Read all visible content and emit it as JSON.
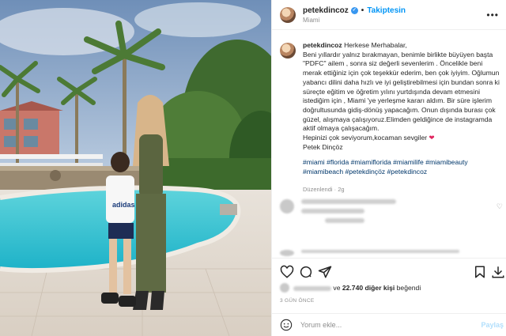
{
  "post": {
    "username": "petekdincoz",
    "verified_icon": "verified-badge-icon",
    "separator": "•",
    "follow_label": "Takiptesin",
    "location": "Miami",
    "more_icon": "more-options-icon"
  },
  "caption": {
    "username": "petekdincoz",
    "heart_emoji": "❤",
    "text_lines": [
      "Herkese Merhabalar,",
      "Beni yıllardır yalnız bırakmayan, benimle birlikte büyüyen başta \"PDFC\" ailem , sonra siz değerli sevenlerim . Öncelikle beni merak ettiğiniz için çok teşekkür ederim, ben çok iyiyim. Oğlumun yabancı dilini daha hızlı ve iyi geliştirebilmesi için bundan sonra ki süreçte eğitim ve öğretim yılını yurtdışında devam etmesini istediğim için , Miami 'ye yerleşme kararı aldım. Bir süre işlerim doğrultusunda gidiş-dönüş yapacağım. Onun dışında burası çok güzel, alışmaya çalışıyoruz.Elimden geldiğince de instagramda aktif olmaya çalışacağım.",
      "Hepinizi çok seviyorum,kocaman sevgiler",
      "Petek Dinçöz"
    ],
    "hashtags": "#miami #florida #miamiflorida #miamilife #miamibeauty #miamibeach #petekdinçöz #petekdincoz",
    "edited": "Düzenlendi · 2g"
  },
  "likes": {
    "prefix": "ve",
    "count_text": "22.740 diğer kişi",
    "suffix": "beğendi"
  },
  "post_time": "3 GÜN ÖNCE",
  "comment_box": {
    "placeholder": "Yorum ekle...",
    "post_label": "Paylaş"
  },
  "icons": [
    "heart-icon",
    "comment-icon",
    "share-icon",
    "save-icon",
    "download-icon",
    "emoji-icon"
  ],
  "colors": {
    "accent": "#0095f6",
    "verified": "#3897f0",
    "text": "#262626",
    "muted": "#8e8e8e",
    "hashtag": "#00376b"
  }
}
